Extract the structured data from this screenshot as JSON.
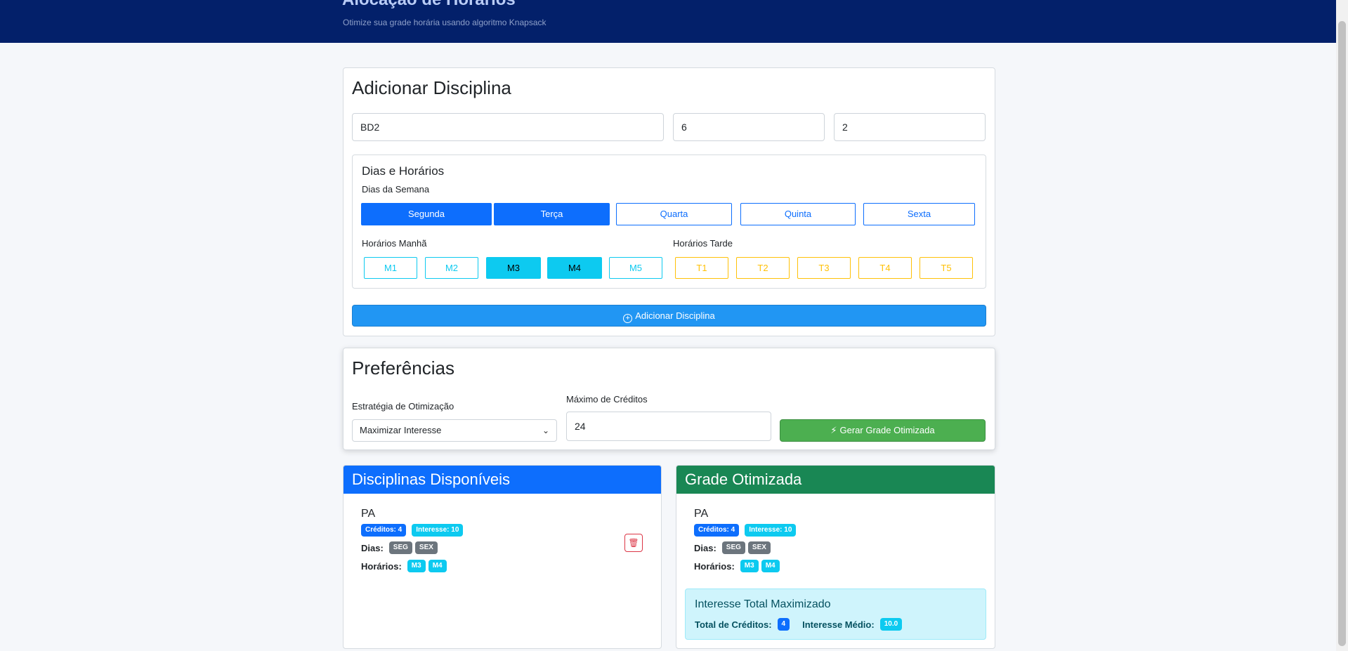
{
  "header": {
    "title": "Alocação de Horários",
    "subtitle": "Otimize sua grade horária usando algoritmo Knapsack"
  },
  "add_form": {
    "title": "Adicionar Disciplina",
    "name_value": "BD2",
    "credits_value": "6",
    "interest_value": "2",
    "schedule_section": {
      "title": "Dias e Horários",
      "days_label": "Dias da Semana",
      "days": [
        {
          "label": "Segunda",
          "selected": true
        },
        {
          "label": "Terça",
          "selected": true
        },
        {
          "label": "Quarta",
          "selected": false
        },
        {
          "label": "Quinta",
          "selected": false
        },
        {
          "label": "Sexta",
          "selected": false
        }
      ],
      "morning_label": "Horários Manhã",
      "morning_slots": [
        {
          "label": "M1",
          "selected": false
        },
        {
          "label": "M2",
          "selected": false
        },
        {
          "label": "M3",
          "selected": true
        },
        {
          "label": "M4",
          "selected": true
        },
        {
          "label": "M5",
          "selected": false
        }
      ],
      "afternoon_label": "Horários Tarde",
      "afternoon_slots": [
        {
          "label": "T1",
          "selected": false
        },
        {
          "label": "T2",
          "selected": false
        },
        {
          "label": "T3",
          "selected": false
        },
        {
          "label": "T4",
          "selected": false
        },
        {
          "label": "T5",
          "selected": false
        }
      ]
    },
    "add_button_label": "Adicionar Disciplina",
    "add_button_icon": "plus-circle-icon"
  },
  "preferences": {
    "title": "Preferências",
    "strategy_label": "Estratégia de Otimização",
    "strategy_selected": "Maximizar Interesse",
    "max_credits_label": "Máximo de Créditos",
    "max_credits_value": "24",
    "generate_button_label": "Gerar Grade Otimizada",
    "generate_button_icon": "lightning-icon"
  },
  "available": {
    "title": "Disciplinas Disponíveis",
    "header_color": "#0d6efd",
    "items": [
      {
        "name": "PA",
        "credits_badge": "Créditos: 4",
        "interest_badge": "Interesse: 10",
        "days_label": "Dias:",
        "days": [
          "SEG",
          "SEX"
        ],
        "slots_label": "Horários:",
        "slots": [
          "M3",
          "M4"
        ]
      }
    ]
  },
  "optimized": {
    "title": "Grade Otimizada",
    "header_color": "#198754",
    "items": [
      {
        "name": "PA",
        "credits_badge": "Créditos: 4",
        "interest_badge": "Interesse: 10",
        "days_label": "Dias:",
        "days": [
          "SEG",
          "SEX"
        ],
        "slots_label": "Horários:",
        "slots": [
          "M3",
          "M4"
        ]
      }
    ],
    "summary": {
      "title": "Interesse Total Maximizado",
      "total_credits_label": "Total de Créditos:",
      "total_credits_value": "4",
      "avg_interest_label": "Interesse Médio:",
      "avg_interest_value": "10.0"
    }
  }
}
